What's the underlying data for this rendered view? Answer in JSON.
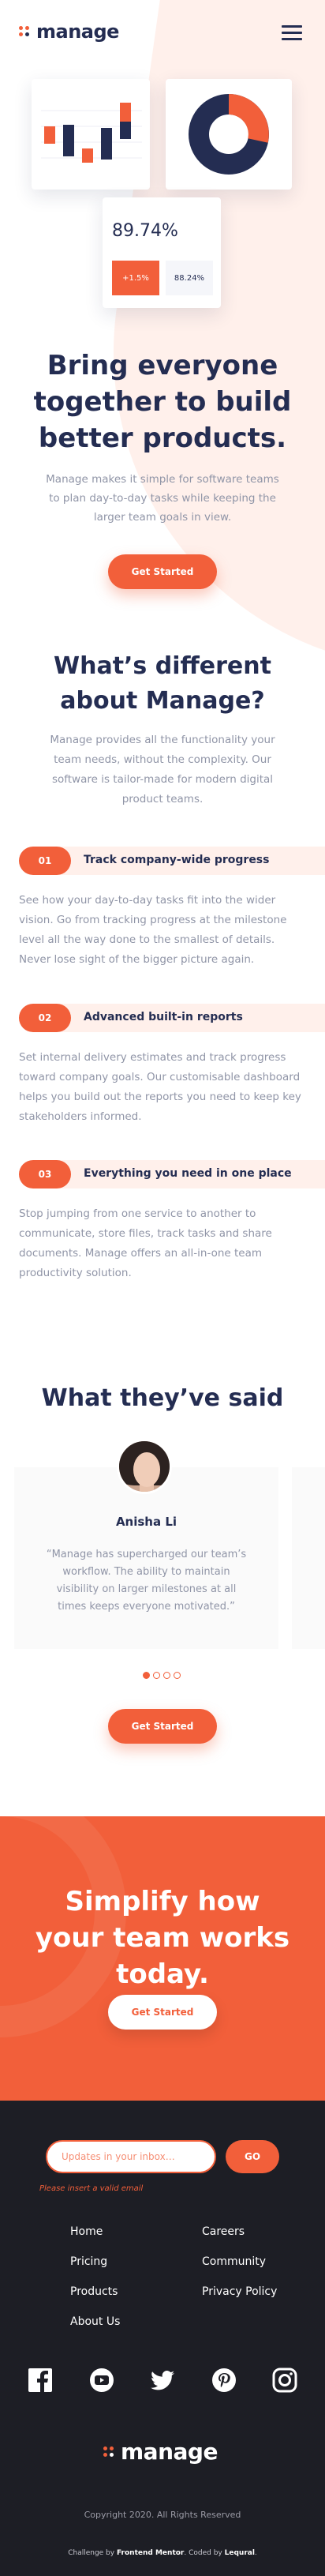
{
  "header": {
    "logo_text": "manage",
    "menu_icon": "hamburger-icon"
  },
  "hero": {
    "stat_main": "89.74%",
    "stat_a": "+1.5%",
    "stat_b": "88.24%",
    "title": "Bring everyone together to build better products.",
    "text": "Manage makes it simple for software teams to plan day-to-day tasks while keeping the larger team goals in view.",
    "button": "Get Started"
  },
  "different": {
    "title": "What’s different about Manage?",
    "text": "Manage provides all the functionality your team needs, without the complexity. Our software is tailor-made for modern digital product teams.",
    "features": [
      {
        "num": "01",
        "title": "Track company-wide progress",
        "desc": "See how your day-to-day tasks fit into the wider vision. Go from tracking progress at the milestone level all the way done to the smallest of details. Never lose sight of the bigger picture again."
      },
      {
        "num": "02",
        "title": "Advanced built-in reports",
        "desc": "Set internal delivery estimates and track progress toward company goals. Our customisable dashboard helps you build out the reports you need to keep key stakeholders informed."
      },
      {
        "num": "03",
        "title": "Everything you need in one place",
        "desc": "Stop jumping from one service to another to communicate, store files, track tasks and share documents. Manage offers an all-in-one team productivity solution."
      }
    ]
  },
  "testimonials": {
    "title": "What they’ve said",
    "name": "Anisha Li",
    "quote": "“Manage has supercharged our team’s workflow. The ability to maintain visibility on larger milestones at all times keeps everyone motivated.”",
    "active_slide": 1,
    "slide_count": 4,
    "button": "Get Started"
  },
  "cta": {
    "title": "Simplify how your team works today.",
    "button": "Get Started"
  },
  "footer": {
    "newsletter_placeholder": "Updates in your inbox…",
    "go": "GO",
    "error": "Please insert a valid email",
    "links_a": [
      "Home",
      "Pricing",
      "Products",
      "About Us"
    ],
    "links_b": [
      "Careers",
      "Community",
      "Privacy Policy"
    ],
    "social_icons": [
      "facebook-icon",
      "youtube-icon",
      "twitter-icon",
      "pinterest-icon",
      "instagram-icon"
    ],
    "logo_text": "manage",
    "copyright": "Copyright 2020. All Rights Reserved",
    "attr_prefix": "Challenge by",
    "attr_fm": "Frontend Mentor",
    "attr_mid": ". Coded by",
    "attr_by": "Lequral",
    "attr_end": "."
  },
  "colors": {
    "accent": "#f25f3a",
    "navy": "#242d52",
    "muted": "#9095a7",
    "pale": "#fff0eb",
    "footer_bg": "#1d1e25"
  }
}
